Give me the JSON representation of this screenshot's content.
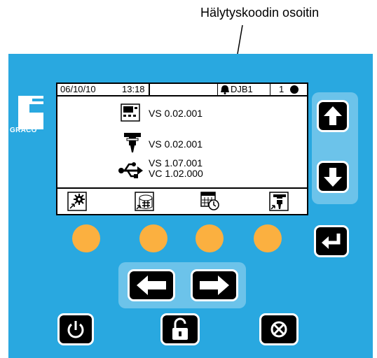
{
  "callout": {
    "label": "Hälytyskoodin osoitin"
  },
  "brand": {
    "name": "GRACO"
  },
  "status_bar": {
    "date": "06/10/10",
    "time": "13:18",
    "alarm_code": "DJB1",
    "unit_number": "1"
  },
  "versions": [
    {
      "icon": "display-module-icon",
      "lines": [
        "VS 0.02.001"
      ]
    },
    {
      "icon": "dispense-valve-icon",
      "lines": [
        "VS 0.02.001"
      ]
    },
    {
      "icon": "usb-icon",
      "lines": [
        "VS 1.07.001",
        "VC 1.02.000"
      ]
    }
  ],
  "softkeys": [
    {
      "icon": "setup-gear-icon"
    },
    {
      "icon": "job-number-icon"
    },
    {
      "icon": "calendar-clock-icon"
    },
    {
      "icon": "valve-setup-icon"
    }
  ],
  "colors": {
    "panel": "#29a8e0",
    "softkey_button": "#fbb040",
    "key": "#000000"
  },
  "keys": [
    "arrow-up-icon",
    "arrow-down-icon",
    "enter-icon",
    "arrow-left-icon",
    "arrow-right-icon",
    "power-icon",
    "unlock-icon",
    "stop-reset-icon"
  ]
}
